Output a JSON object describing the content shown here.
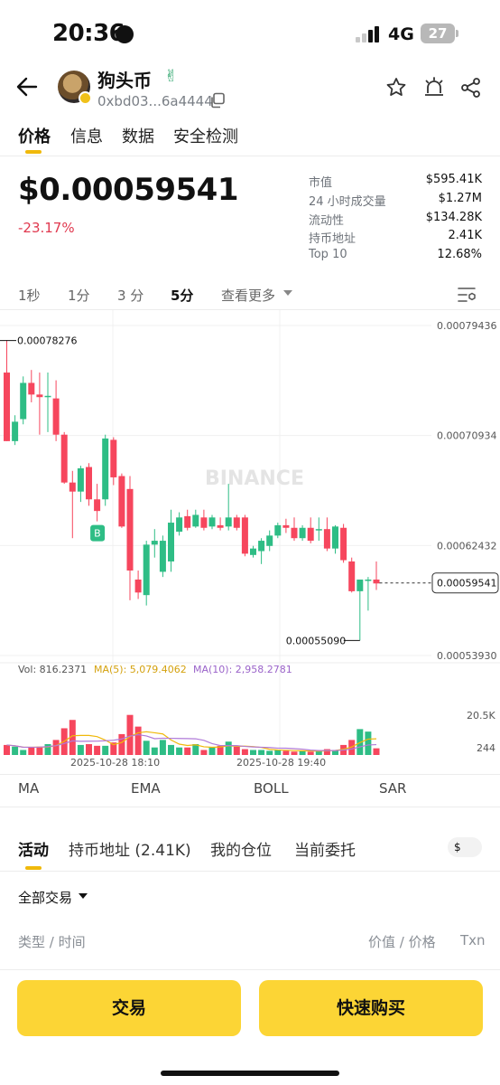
{
  "status_bar": {
    "time": "20:36",
    "network": "4G",
    "battery": "27"
  },
  "token": {
    "name": "狗头币",
    "address": "0xbd03...6a4444"
  },
  "main_tabs": [
    "价格",
    "信息",
    "数据",
    "安全检测"
  ],
  "price": {
    "value": "$0.00059541",
    "change": "-23.17%"
  },
  "stats": [
    {
      "label": "市值",
      "value": "$595.41K"
    },
    {
      "label": "24 小时成交量",
      "value": "$1.27M"
    },
    {
      "label": "流动性",
      "value": "$134.28K"
    },
    {
      "label": "持币地址",
      "value": "2.41K"
    },
    {
      "label": "Top 10",
      "value": "12.68%"
    }
  ],
  "intervals": [
    "1秒",
    "1分",
    "3 分",
    "5分",
    "查看更多"
  ],
  "chart_data": {
    "type": "candlestick",
    "watermark": "BINANCE",
    "y_ticks": [
      "0.00079436",
      "0.00070934",
      "0.00062432",
      "0.00053930"
    ],
    "high_label": "0.00078276",
    "low_label": "0.00055090",
    "current_label": "0.00059541",
    "marker": "B",
    "x_labels": [
      "2025-10-28 18:10",
      "2025-10-28 19:40"
    ],
    "volume_legend": {
      "vol": "Vol: 816.2371",
      "ma5": "MA(5): 5,079.4062",
      "ma10": "MA(10): 2,958.2781"
    },
    "volume_ticks": [
      "20.5K",
      "244"
    ],
    "up_color": "#2ebd85",
    "down_color": "#f6465d",
    "ma5_color": "#f0b90b",
    "ma10_color": "#b07ad8",
    "candles": [
      {
        "o": 0.000758,
        "h": 0.000783,
        "l": 0.000705,
        "c": 0.000705
      },
      {
        "o": 0.000705,
        "h": 0.000725,
        "l": 0.000702,
        "c": 0.00072
      },
      {
        "o": 0.000722,
        "h": 0.000755,
        "l": 0.000718,
        "c": 0.00075
      },
      {
        "o": 0.00075,
        "h": 0.00076,
        "l": 0.000735,
        "c": 0.000741
      },
      {
        "o": 0.000741,
        "h": 0.000758,
        "l": 0.00071,
        "c": 0.000739
      },
      {
        "o": 0.000739,
        "h": 0.000758,
        "l": 0.000712,
        "c": 0.00074
      },
      {
        "o": 0.000738,
        "h": 0.000752,
        "l": 0.000705,
        "c": 0.00071
      },
      {
        "o": 0.00071,
        "h": 0.000712,
        "l": 0.000672,
        "c": 0.000673
      },
      {
        "o": 0.000673,
        "h": 0.000682,
        "l": 0.00063,
        "c": 0.000666
      },
      {
        "o": 0.000666,
        "h": 0.000686,
        "l": 0.000658,
        "c": 0.000684
      },
      {
        "o": 0.000685,
        "h": 0.000688,
        "l": 0.000655,
        "c": 0.00066
      },
      {
        "o": 0.00066,
        "h": 0.000672,
        "l": 0.000643,
        "c": 0.000651
      },
      {
        "o": 0.00066,
        "h": 0.00071,
        "l": 0.000655,
        "c": 0.000707
      },
      {
        "o": 0.000706,
        "h": 0.000708,
        "l": 0.000671,
        "c": 0.000677
      },
      {
        "o": 0.000678,
        "h": 0.00068,
        "l": 0.000638,
        "c": 0.000639
      },
      {
        "o": 0.000668,
        "h": 0.000678,
        "l": 0.000582,
        "c": 0.000605
      },
      {
        "o": 0.000598,
        "h": 0.000605,
        "l": 0.000583,
        "c": 0.000588
      },
      {
        "o": 0.000586,
        "h": 0.000628,
        "l": 0.000578,
        "c": 0.000625
      },
      {
        "o": 0.000625,
        "h": 0.000637,
        "l": 0.000615,
        "c": 0.000628
      },
      {
        "o": 0.000604,
        "h": 0.000632,
        "l": 0.0006,
        "c": 0.000628
      },
      {
        "o": 0.000612,
        "h": 0.000652,
        "l": 0.000604,
        "c": 0.000642
      },
      {
        "o": 0.000635,
        "h": 0.00065,
        "l": 0.000632,
        "c": 0.000646
      },
      {
        "o": 0.000647,
        "h": 0.000652,
        "l": 0.000636,
        "c": 0.000638
      },
      {
        "o": 0.000639,
        "h": 0.000652,
        "l": 0.000638,
        "c": 0.000648
      },
      {
        "o": 0.000646,
        "h": 0.000652,
        "l": 0.000636,
        "c": 0.000638
      },
      {
        "o": 0.000639,
        "h": 0.000648,
        "l": 0.000637,
        "c": 0.000646
      },
      {
        "o": 0.00064,
        "h": 0.000646,
        "l": 0.000636,
        "c": 0.000638
      },
      {
        "o": 0.000639,
        "h": 0.000672,
        "l": 0.000636,
        "c": 0.000646
      },
      {
        "o": 0.000646,
        "h": 0.000648,
        "l": 0.000636,
        "c": 0.000638
      },
      {
        "o": 0.000646,
        "h": 0.000648,
        "l": 0.000616,
        "c": 0.000618
      },
      {
        "o": 0.000617,
        "h": 0.000624,
        "l": 0.000615,
        "c": 0.000622
      },
      {
        "o": 0.00062,
        "h": 0.00063,
        "l": 0.00061,
        "c": 0.000628
      },
      {
        "o": 0.000624,
        "h": 0.000636,
        "l": 0.00062,
        "c": 0.000632
      },
      {
        "o": 0.000632,
        "h": 0.000642,
        "l": 0.00063,
        "c": 0.00064
      },
      {
        "o": 0.00064,
        "h": 0.000645,
        "l": 0.000634,
        "c": 0.000638
      },
      {
        "o": 0.000638,
        "h": 0.000646,
        "l": 0.000628,
        "c": 0.00063
      },
      {
        "o": 0.00063,
        "h": 0.00064,
        "l": 0.000628,
        "c": 0.000638
      },
      {
        "o": 0.000638,
        "h": 0.000646,
        "l": 0.000626,
        "c": 0.000628
      },
      {
        "o": 0.000636,
        "h": 0.000646,
        "l": 0.000628,
        "c": 0.000637
      },
      {
        "o": 0.000637,
        "h": 0.000646,
        "l": 0.00062,
        "c": 0.000622
      },
      {
        "o": 0.000622,
        "h": 0.00064,
        "l": 0.000618,
        "c": 0.000639
      },
      {
        "o": 0.000638,
        "h": 0.000641,
        "l": 0.000611,
        "c": 0.000613
      },
      {
        "o": 0.000612,
        "h": 0.000615,
        "l": 0.000588,
        "c": 0.000589
      },
      {
        "o": 0.000589,
        "h": 0.000598,
        "l": 0.000551,
        "c": 0.000598
      },
      {
        "o": 0.000598,
        "h": 0.0006,
        "l": 0.000574,
        "c": 0.000598
      },
      {
        "o": 0.000598,
        "h": 0.000612,
        "l": 0.00059,
        "c": 0.000595
      }
    ],
    "volumes": [
      1.2,
      1.0,
      0.6,
      0.9,
      1.0,
      1.3,
      1.8,
      3.2,
      4.2,
      1.2,
      1.3,
      1.1,
      1.1,
      1.5,
      2.5,
      4.8,
      3.4,
      1.7,
      0.9,
      1.8,
      1.2,
      0.9,
      0.9,
      1.3,
      0.6,
      0.9,
      1.1,
      1.6,
      1.0,
      0.7,
      0.6,
      0.6,
      0.5,
      0.6,
      0.5,
      0.4,
      0.5,
      0.4,
      0.5,
      0.7,
      0.6,
      1.2,
      1.8,
      3.1,
      2.8,
      0.8
    ],
    "volume_max": 6.5
  },
  "indicators": [
    "MA",
    "EMA",
    "BOLL",
    "SAR"
  ],
  "activity_tabs": [
    "活动",
    "持币地址 (2.41K)",
    "我的仓位",
    "当前委托"
  ],
  "currency_toggle": "$",
  "filter": "全部交易",
  "columns": {
    "left": "类型 / 时间",
    "mid": "价值 / 价格",
    "right": "Txn"
  },
  "buttons": {
    "trade": "交易",
    "quick_buy": "快速购买"
  }
}
